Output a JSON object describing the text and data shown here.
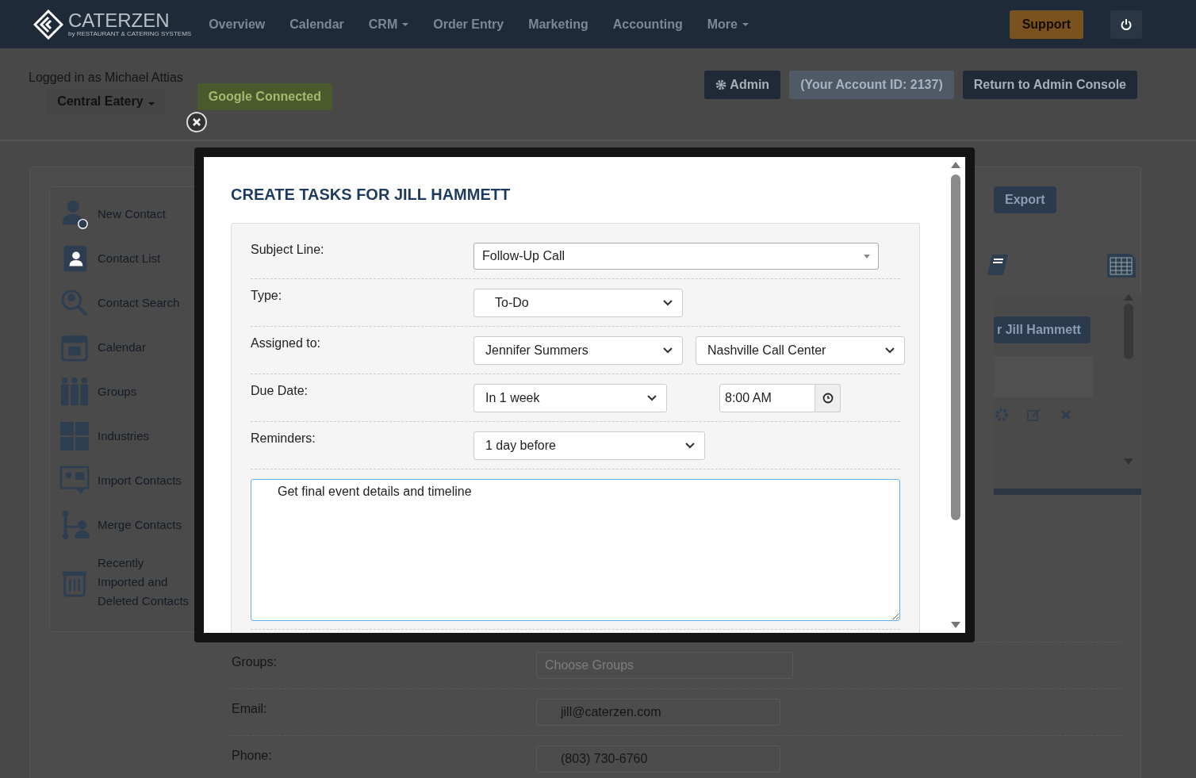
{
  "navbar": {
    "brand": "CATERZEN",
    "tagline": "by RESTAURANT & CATERING SYSTEMS",
    "menu": [
      {
        "label": "Overview",
        "dropdown": false
      },
      {
        "label": "Calendar",
        "dropdown": false
      },
      {
        "label": "CRM",
        "dropdown": true
      },
      {
        "label": "Order Entry",
        "dropdown": false
      },
      {
        "label": "Marketing",
        "dropdown": false
      },
      {
        "label": "Accounting",
        "dropdown": false
      },
      {
        "label": "More",
        "dropdown": true
      }
    ],
    "support": "Support"
  },
  "account_bar": {
    "logged_in": "Logged in as Michael Attias",
    "location": "Central Eatery",
    "google": "Google Connected",
    "admin": "Admin",
    "account_id": "(Your Account ID: 2137)",
    "return": "Return to Admin Console"
  },
  "sidebar": {
    "items": [
      {
        "label": "New Contact",
        "kind": "person-plus"
      },
      {
        "label": "Contact List",
        "kind": "book"
      },
      {
        "label": "Contact Search",
        "kind": "search"
      },
      {
        "label": "Calendar",
        "kind": "calendar"
      },
      {
        "label": "Groups",
        "kind": "group"
      },
      {
        "label": "Industries",
        "kind": "grid"
      },
      {
        "label": "Import Contacts",
        "kind": "import"
      },
      {
        "label": "Merge Contacts",
        "kind": "merge"
      },
      {
        "label": "Recently Imported and Deleted Contacts",
        "kind": "trash"
      }
    ]
  },
  "contact_panel": {
    "export": "Export",
    "task_button": "r Jill Hammett",
    "fields": [
      {
        "label": "Groups:",
        "placeholder": "Choose Groups"
      },
      {
        "label": "Email:",
        "value": "jill@caterzen.com"
      },
      {
        "label": "Phone:",
        "value": "(803) 730-6760"
      }
    ]
  },
  "modal": {
    "title": "CREATE TASKS FOR JILL HAMMETT",
    "subject": {
      "label": "Subject Line:",
      "value": "Follow-Up Call"
    },
    "type": {
      "label": "Type:",
      "value": "To-Do"
    },
    "assigned": {
      "label": "Assigned to:",
      "person": "Jennifer Summers",
      "team": "Nashville Call Center"
    },
    "due": {
      "label": "Due Date:",
      "value": "In 1 week",
      "time": "8:00 AM"
    },
    "reminders": {
      "label": "Reminders:",
      "value": "1 day before"
    },
    "notes": "Get final event details and timeline"
  }
}
